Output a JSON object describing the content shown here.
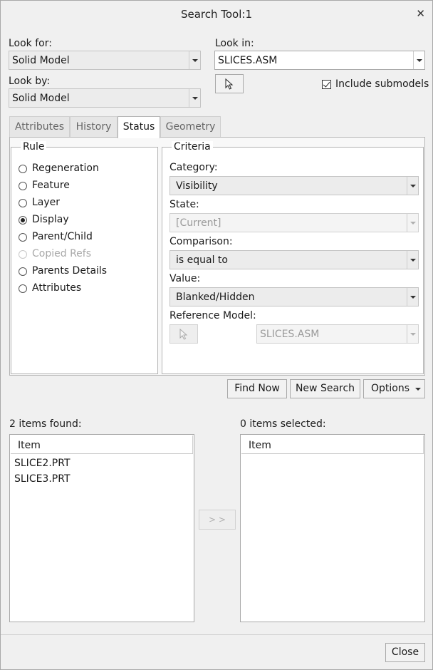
{
  "window": {
    "title": "Search Tool:1"
  },
  "look_for": {
    "label": "Look for:",
    "value": "Solid Model"
  },
  "look_by": {
    "label": "Look by:",
    "value": "Solid Model"
  },
  "look_in": {
    "label": "Look in:",
    "value": "SLICES.ASM",
    "include_submodels_label": "Include submodels",
    "include_submodels_checked": true
  },
  "tabs": [
    {
      "label": "Attributes",
      "active": false
    },
    {
      "label": "History",
      "active": false
    },
    {
      "label": "Status",
      "active": true
    },
    {
      "label": "Geometry",
      "active": false
    }
  ],
  "rule": {
    "legend": "Rule",
    "options": [
      {
        "label": "Regeneration",
        "selected": false,
        "disabled": false
      },
      {
        "label": "Feature",
        "selected": false,
        "disabled": false
      },
      {
        "label": "Layer",
        "selected": false,
        "disabled": false
      },
      {
        "label": "Display",
        "selected": true,
        "disabled": false
      },
      {
        "label": "Parent/Child",
        "selected": false,
        "disabled": false
      },
      {
        "label": "Copied Refs",
        "selected": false,
        "disabled": true
      },
      {
        "label": "Parents Details",
        "selected": false,
        "disabled": false
      },
      {
        "label": "Attributes",
        "selected": false,
        "disabled": false
      }
    ]
  },
  "criteria": {
    "legend": "Criteria",
    "category_label": "Category:",
    "category_value": "Visibility",
    "state_label": "State:",
    "state_value": "[Current]",
    "comparison_label": "Comparison:",
    "comparison_value": "is equal to",
    "value_label": "Value:",
    "value_value": "Blanked/Hidden",
    "reference_model_label": "Reference Model:",
    "reference_model_value": "SLICES.ASM"
  },
  "actions": {
    "find_now": "Find Now",
    "new_search": "New Search",
    "options": "Options"
  },
  "results": {
    "found_label": "2 items found:",
    "found_header": "Item",
    "found_items": [
      "SLICE2.PRT",
      "SLICE3.PRT"
    ],
    "transfer_label": "> >",
    "selected_label": "0 items selected:",
    "selected_header": "Item"
  },
  "footer": {
    "close": "Close"
  }
}
